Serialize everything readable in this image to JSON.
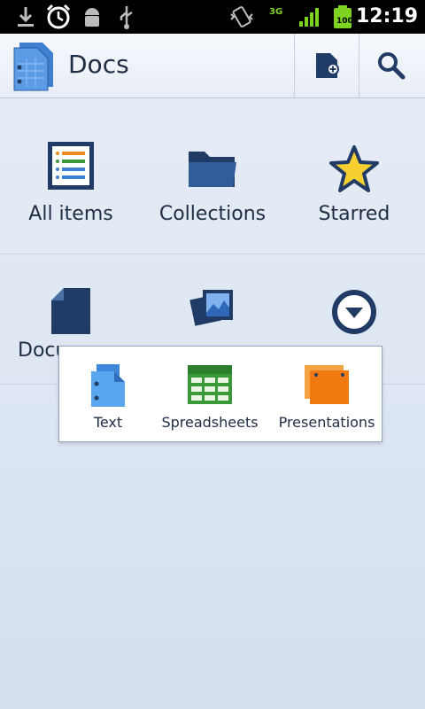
{
  "status_bar": {
    "time": "12:19",
    "network_label": "3G",
    "battery_level": "100",
    "icons": [
      "download-icon",
      "alarm-icon",
      "android-icon",
      "usb-icon",
      "vibrate-icon",
      "network-3g-icon",
      "signal-icon",
      "battery-icon"
    ]
  },
  "app_bar": {
    "title": "Docs",
    "actions": [
      "new-document-icon",
      "search-icon"
    ]
  },
  "grid": {
    "all_items": "All items",
    "collections": "Collections",
    "starred": "Starred",
    "documents_truncated": "Docu"
  },
  "popup": {
    "text": "Text",
    "spreadsheets": "Spreadsheets",
    "presentations": "Presentations"
  },
  "colors": {
    "app_bar_bg": "#f0f3f8",
    "text": "#1f2c44",
    "accent_blue": "#1f3b66",
    "star": "#f5d030",
    "sheets_green": "#3a9a3a",
    "slides_orange": "#f07a10"
  }
}
